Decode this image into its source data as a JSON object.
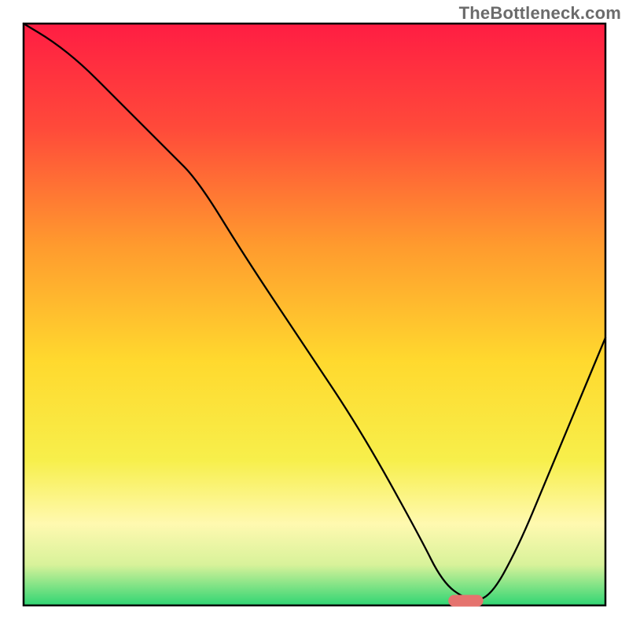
{
  "watermark": "TheBottleneck.com",
  "chart_data": {
    "type": "line",
    "title": "",
    "xlabel": "",
    "ylabel": "",
    "xlim": [
      0,
      100
    ],
    "ylim": [
      0,
      100
    ],
    "grid": false,
    "legend": false,
    "background_gradient": {
      "stops": [
        {
          "offset": 0.0,
          "color": "#ff1d43"
        },
        {
          "offset": 0.18,
          "color": "#ff4a3a"
        },
        {
          "offset": 0.38,
          "color": "#ff9a2e"
        },
        {
          "offset": 0.58,
          "color": "#ffd92e"
        },
        {
          "offset": 0.75,
          "color": "#f7ef4b"
        },
        {
          "offset": 0.86,
          "color": "#fff9b0"
        },
        {
          "offset": 0.93,
          "color": "#d8f29a"
        },
        {
          "offset": 1.0,
          "color": "#2fd573"
        }
      ]
    },
    "series": [
      {
        "name": "bottleneck-curve",
        "color": "#000000",
        "width": 2.3,
        "x": [
          0,
          5,
          10,
          15,
          20,
          25,
          30,
          38,
          48,
          58,
          68,
          72,
          76,
          80,
          85,
          90,
          95,
          100
        ],
        "y": [
          100,
          97,
          93,
          88,
          83,
          78,
          73,
          60,
          45,
          30,
          12,
          4,
          1,
          1,
          10,
          22,
          34,
          46
        ]
      }
    ],
    "marker": {
      "name": "optimal-zone",
      "shape": "rounded-bar",
      "color": "#e5736e",
      "x_center": 76,
      "y_center": 0.8,
      "width": 6,
      "height": 2,
      "rx": 1
    }
  }
}
